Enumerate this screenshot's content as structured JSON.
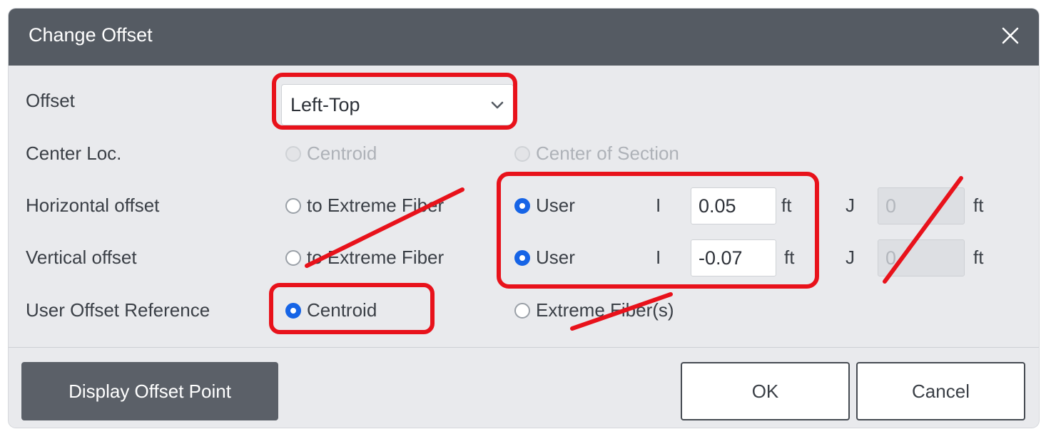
{
  "dialog": {
    "title": "Change Offset",
    "close_icon": "close-icon"
  },
  "offset": {
    "label": "Offset",
    "selected": "Left-Top"
  },
  "center_loc": {
    "label": "Center Loc.",
    "options": [
      "Centroid",
      "Center of Section"
    ],
    "disabled": true
  },
  "horizontal": {
    "label": "Horizontal offset",
    "option_extreme": "to Extreme Fiber",
    "option_user": "User",
    "selected": "User",
    "i_label": "I",
    "i_value": "0.05",
    "i_unit": "ft",
    "j_label": "J",
    "j_value": "0",
    "j_unit": "ft"
  },
  "vertical": {
    "label": "Vertical offset",
    "option_extreme": "to Extreme Fiber",
    "option_user": "User",
    "selected": "User",
    "i_label": "I",
    "i_value": "-0.07",
    "i_unit": "ft",
    "j_label": "J",
    "j_value": "0",
    "j_unit": "ft"
  },
  "reference": {
    "label": "User Offset Reference",
    "options": [
      "Centroid",
      "Extreme Fiber(s)"
    ],
    "selected": "Centroid"
  },
  "buttons": {
    "display": "Display Offset Point",
    "ok": "OK",
    "cancel": "Cancel"
  },
  "colors": {
    "titlebar": "#555b63",
    "accent": "#1664e6",
    "annotation": "#e8121b"
  }
}
